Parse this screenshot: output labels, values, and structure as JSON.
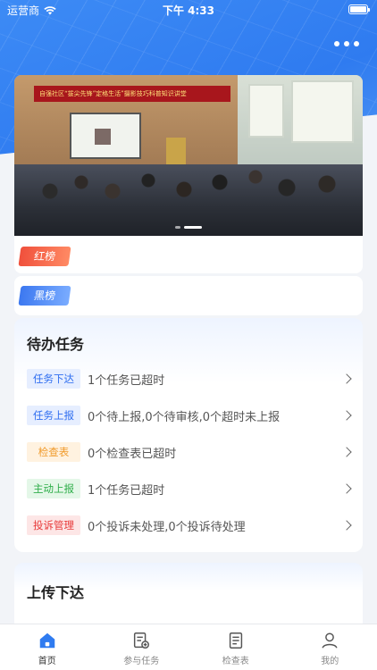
{
  "status_bar": {
    "carrier": "运营商",
    "time": "下午 4:33"
  },
  "banner": {
    "banner_text": "自强社区“拔尖先锋”定格生活”摄影技巧科普知识讲堂",
    "pages": 2,
    "active_page": 2
  },
  "rankings": {
    "red_label": "红榜",
    "black_label": "黑榜"
  },
  "todo": {
    "title": "待办任务",
    "items": [
      {
        "tag": "任务下达",
        "color": "blue",
        "text": "1个任务已超时"
      },
      {
        "tag": "任务上报",
        "color": "blue",
        "text": "0个待上报,0个待审核,0个超时未上报"
      },
      {
        "tag": "检查表",
        "color": "orange",
        "text": "0个检查表已超时"
      },
      {
        "tag": "主动上报",
        "color": "green",
        "text": "1个任务已超时"
      },
      {
        "tag": "投诉管理",
        "color": "red",
        "text": "0个投诉未处理,0个投诉待处理"
      }
    ]
  },
  "upload": {
    "title": "上传下达"
  },
  "tabbar": {
    "tabs": [
      {
        "label": "首页",
        "icon": "home-icon",
        "active": true
      },
      {
        "label": "参与任务",
        "icon": "task-icon",
        "active": false
      },
      {
        "label": "检查表",
        "icon": "checklist-icon",
        "active": false
      },
      {
        "label": "我的",
        "icon": "profile-icon",
        "active": false
      }
    ]
  },
  "colors": {
    "primary": "#2f7bf0",
    "red_badge": "#f0503c",
    "blue_badge": "#3c78f0"
  }
}
